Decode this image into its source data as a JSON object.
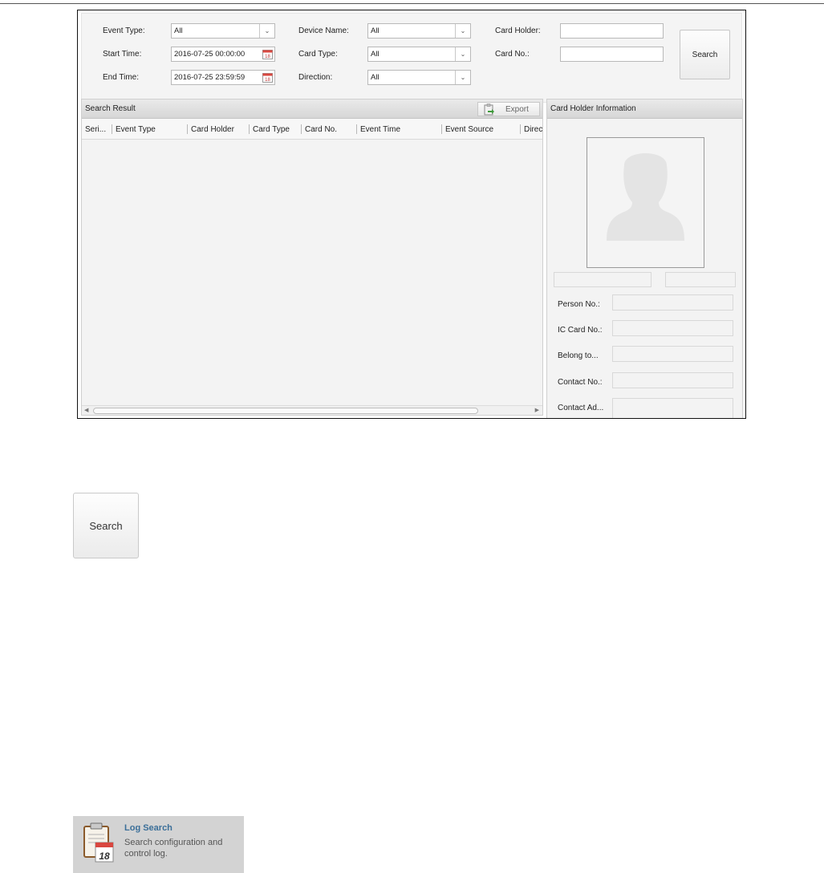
{
  "filters": {
    "event_type": {
      "label": "Event Type:",
      "value": "All"
    },
    "start_time": {
      "label": "Start Time:",
      "value": "2016-07-25 00:00:00"
    },
    "end_time": {
      "label": "End Time:",
      "value": "2016-07-25 23:59:59"
    },
    "device_name": {
      "label": "Device Name:",
      "value": "All"
    },
    "card_type": {
      "label": "Card Type:",
      "value": "All"
    },
    "direction": {
      "label": "Direction:",
      "value": "All"
    },
    "card_holder": {
      "label": "Card Holder:",
      "value": ""
    },
    "card_no": {
      "label": "Card No.:",
      "value": ""
    },
    "search_label": "Search",
    "dropdown_arrow": "chevron-down-icon",
    "calendar_icon": "calendar-icon"
  },
  "results": {
    "title": "Search Result",
    "export_label": "Export",
    "columns": [
      "Seri...",
      "Event Type",
      "Card Holder",
      "Card Type",
      "Card No.",
      "Event Time",
      "Event Source",
      "Direc"
    ]
  },
  "card_info": {
    "title": "Card Holder Information",
    "fields": [
      "Person No.:",
      "IC Card No.:",
      "Belong to...",
      "Contact No.:",
      "Contact Ad..."
    ]
  },
  "big_search": {
    "label": "Search"
  },
  "log_search": {
    "title": "Log Search",
    "description": "Search configuration and control log.",
    "icon_day": "18"
  },
  "colors": {
    "log_title": "#3b6f99",
    "calendar_red": "#d9473f",
    "tile_bg": "#d3d3d3"
  }
}
